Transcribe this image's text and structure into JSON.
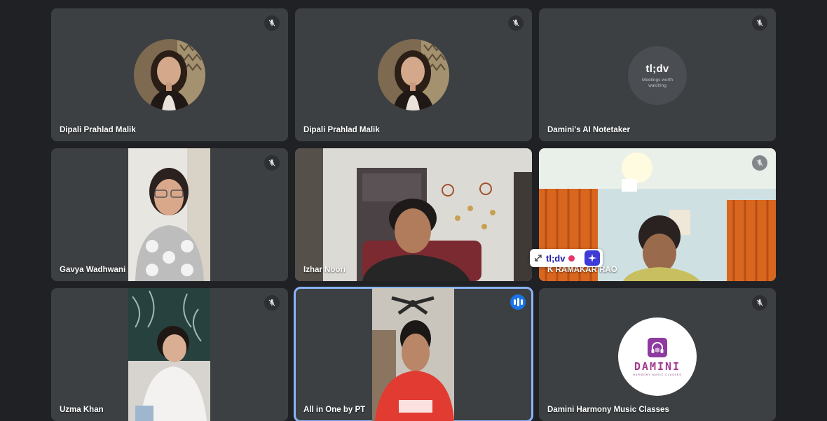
{
  "participants": [
    {
      "name": "Dipali Prahlad Malik",
      "muted": true
    },
    {
      "name": "Dipali Prahlad Malik",
      "muted": true
    },
    {
      "name": "Damini's AI Notetaker",
      "muted": true,
      "logo": {
        "title": "tl;dv",
        "subtitle": "Meetings worth watching"
      }
    },
    {
      "name": "Gavya Wadhwani",
      "muted": true
    },
    {
      "name": "Izhar Noori",
      "muted": false
    },
    {
      "name": "K RAMAKAR RAO",
      "muted": true
    },
    {
      "name": "Uzma Khan",
      "muted": true
    },
    {
      "name": "All in One by PT",
      "muted": false,
      "speaking": true
    },
    {
      "name": "Damini Harmony Music Classes",
      "muted": true,
      "logo": {
        "word": "DAMINI",
        "tagline": "HARMONY MUSIC CLASSES"
      }
    }
  ],
  "tldv_widget": {
    "label": "tl;dv",
    "recording": true
  },
  "icons": {
    "muted": "mic-off-icon",
    "speaking": "audio-level-icon",
    "expand": "expand-icon",
    "ai": "sparkle-icon"
  },
  "colors": {
    "background": "#202124",
    "tile": "#3c4043",
    "speaking_outline": "#8ab4f8",
    "speaking_badge": "#1a73e8",
    "record": "#e8336a",
    "tldv_brand": "#3d3ad6",
    "damini_brand": "#a23a8f"
  }
}
